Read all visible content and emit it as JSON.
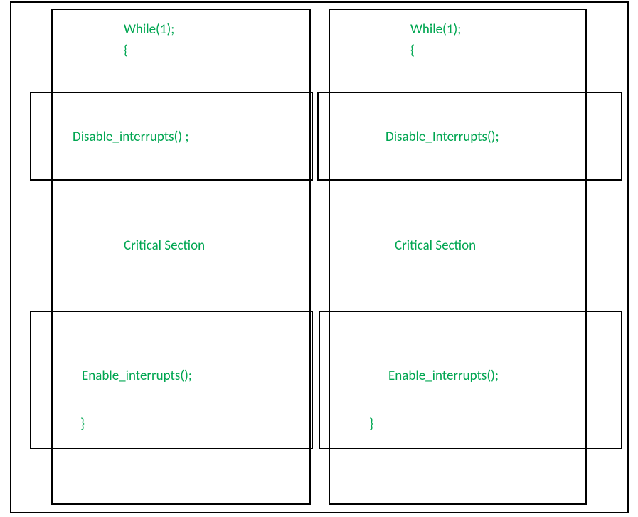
{
  "left": {
    "while_line": "While(1);",
    "open_brace": "{",
    "disable": "Disable_interrupts() ;",
    "critical": "Critical Section",
    "enable": "Enable_interrupts();",
    "close_brace": "}"
  },
  "right": {
    "while_line": "While(1);",
    "open_brace": "{",
    "disable": "Disable_Interrupts();",
    "critical": "Critical Section",
    "enable": "Enable_interrupts();",
    "close_brace": "}"
  }
}
